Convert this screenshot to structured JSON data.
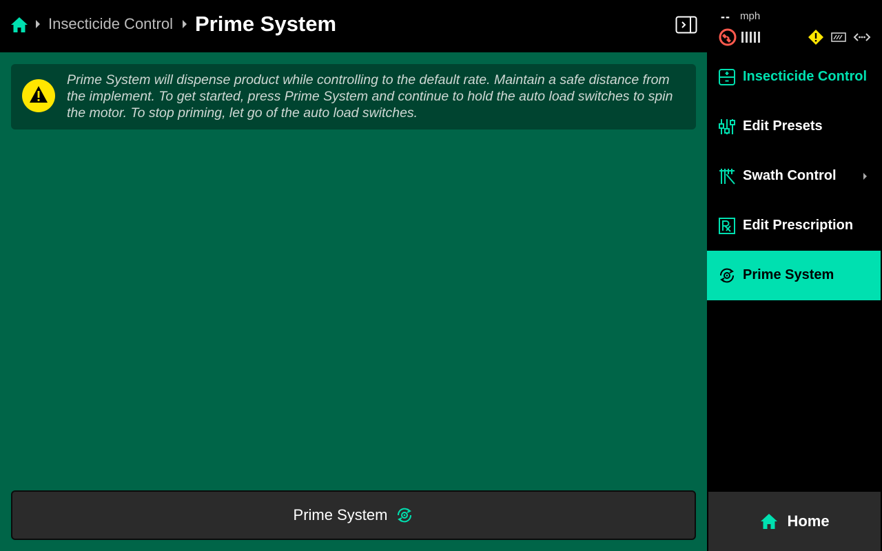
{
  "header": {
    "breadcrumb_parent": "Insecticide Control",
    "title": "Prime System"
  },
  "status": {
    "speed_value": "--",
    "speed_unit": "mph"
  },
  "warning": {
    "message": "Prime System will dispense product while controlling to the default rate. Maintain a safe distance from the implement. To get started, press Prime System and continue to hold the auto load switches to spin the motor. To stop priming, let go of the auto load switches."
  },
  "main": {
    "prime_button_label": "Prime System"
  },
  "sidebar": {
    "items": [
      {
        "label": "Insecticide Control",
        "icon": "insecticide-control-icon"
      },
      {
        "label": "Edit Presets",
        "icon": "presets-sliders-icon"
      },
      {
        "label": "Swath Control",
        "icon": "swath-control-icon"
      },
      {
        "label": "Edit Prescription",
        "icon": "prescription-icon"
      },
      {
        "label": "Prime System",
        "icon": "prime-system-icon"
      }
    ],
    "home_label": "Home"
  },
  "colors": {
    "accent": "#00e0b0",
    "main_bg": "#006548",
    "warning_bg": "#004430",
    "alert_yellow": "#ffe600",
    "gps_red": "#ff5a4e"
  }
}
